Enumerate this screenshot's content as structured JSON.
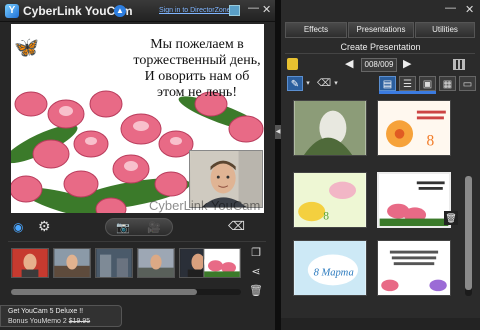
{
  "app": {
    "title": "CyberLink YouCam",
    "signin_link": "Sign in to DirectorZone"
  },
  "preview": {
    "card_text": "Мы пожелаем в торжественный день, И оворить нам об этом не лень!",
    "watermark": "CyberLink YouCam"
  },
  "capture": {
    "snapshot_icon": "camera-icon",
    "record_icon": "video-icon"
  },
  "promo": {
    "line1": "Get YouCam 5 Deluxe !!",
    "line2_prefix": "Bonus YouMemo 2",
    "line2_old_price": "$19.95"
  },
  "right_panel": {
    "tabs": [
      "Effects",
      "Presentations",
      "Utilities"
    ],
    "title": "Create Presentation",
    "page_indicator": "008/009"
  },
  "colors": {
    "accent": "#2c5f9e",
    "selection_bar": "#3b7be0",
    "link": "#7fb5ff"
  }
}
